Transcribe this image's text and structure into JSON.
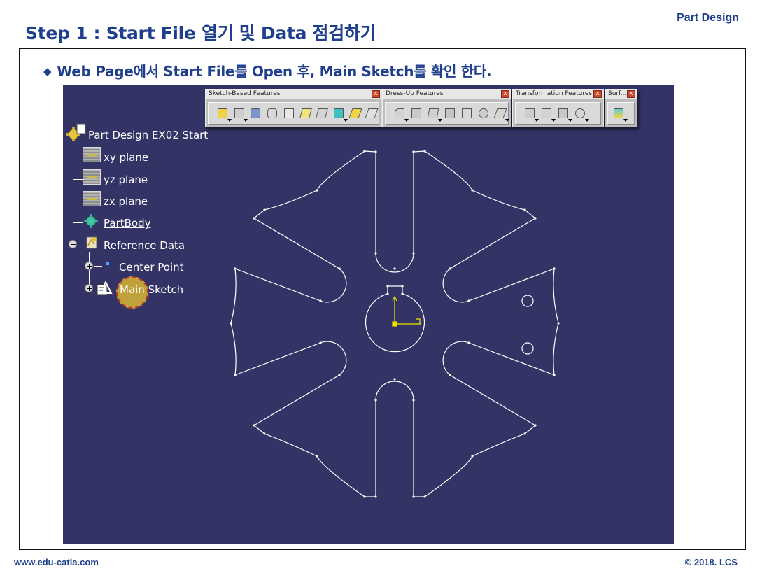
{
  "slide": {
    "title": "Step 1 : Start File 열기 및 Data 점검하기",
    "product_label": "Part Design",
    "instruction": "Web Page에서 Start File를 Open 후, Main Sketch를 확인 한다.",
    "bullet_symbol": "◆"
  },
  "toolbars": [
    {
      "title": "Sketch-Based Features",
      "close": "x"
    },
    {
      "title": "Dress-Up Features",
      "close": "x"
    },
    {
      "title": "Transformation Features",
      "close": "x"
    },
    {
      "title": "Surf...",
      "close": "x"
    }
  ],
  "tree": {
    "root": "Part Design EX02 Start",
    "xy_plane": "xy plane",
    "yz_plane": "yz plane",
    "zx_plane": "zx plane",
    "part_body": "PartBody",
    "reference_data": "Reference Data",
    "center_point": "Center Point",
    "main_sketch": "Main Sketch"
  },
  "colors": {
    "title_blue": "#1f3f8c",
    "viewport_background": "#333366",
    "sketch_line": "#ffffff",
    "axis_yellow": "#e6e600"
  },
  "footer": {
    "website": "www.edu-catia.com",
    "copyright": "© 2018. LCS"
  }
}
